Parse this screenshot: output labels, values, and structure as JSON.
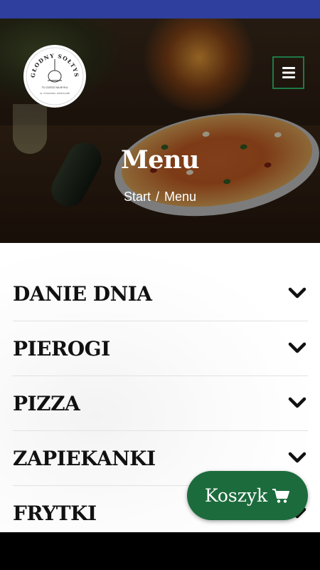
{
  "header": {
    "title": "Menu",
    "breadcrumb": {
      "home": "Start",
      "separator": "/",
      "current": "Menu"
    },
    "logo": {
      "name_top": "GŁODNY SOŁTYS",
      "tagline": "TU ZJESZ NA BYKU",
      "address": "UL. KOLEJOWA, NOWOGARD",
      "logo_name": "glodny-soltys-logo"
    },
    "menu_icon": "hamburger-icon"
  },
  "categories": [
    {
      "label": "DANIE DNIA"
    },
    {
      "label": "PIEROGI"
    },
    {
      "label": "PIZZA"
    },
    {
      "label": "ZAPIEKANKI"
    },
    {
      "label": "FRYTKI"
    }
  ],
  "cart": {
    "label": "Koszyk",
    "icon": "cart-icon"
  },
  "colors": {
    "status_bar": "#2f3f9e",
    "accent_green": "#1c6b3c",
    "toggle_border": "#1f7a46"
  }
}
